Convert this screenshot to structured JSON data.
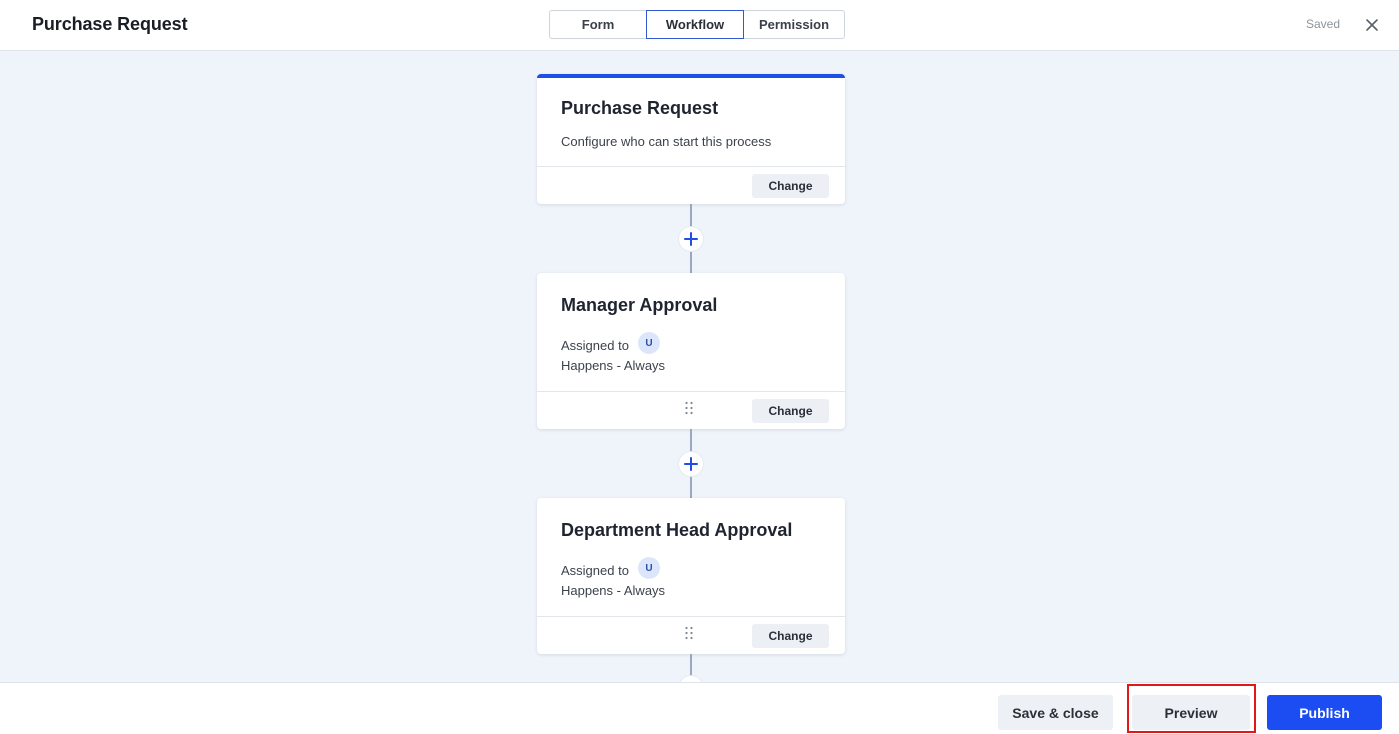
{
  "header": {
    "title": "Purchase Request",
    "tabs": [
      {
        "label": "Form"
      },
      {
        "label": "Workflow",
        "active": true
      },
      {
        "label": "Permission"
      }
    ],
    "status": "Saved",
    "close_icon": "close-icon"
  },
  "workflow": {
    "start": {
      "title": "Purchase Request",
      "subtitle": "Configure who can start this process",
      "change_label": "Change"
    },
    "steps": [
      {
        "title": "Manager Approval",
        "assigned_label": "Assigned to",
        "assignee_initial": "U",
        "happens": "Happens - Always",
        "change_label": "Change"
      },
      {
        "title": "Department Head Approval",
        "assigned_label": "Assigned to",
        "assignee_initial": "U",
        "happens": "Happens - Always",
        "change_label": "Change"
      }
    ]
  },
  "footer": {
    "save_close_label": "Save & close",
    "preview_label": "Preview",
    "publish_label": "Publish"
  },
  "colors": {
    "accent": "#1b4df2",
    "canvas_bg": "#eff3fa",
    "highlight": "#e01818"
  }
}
